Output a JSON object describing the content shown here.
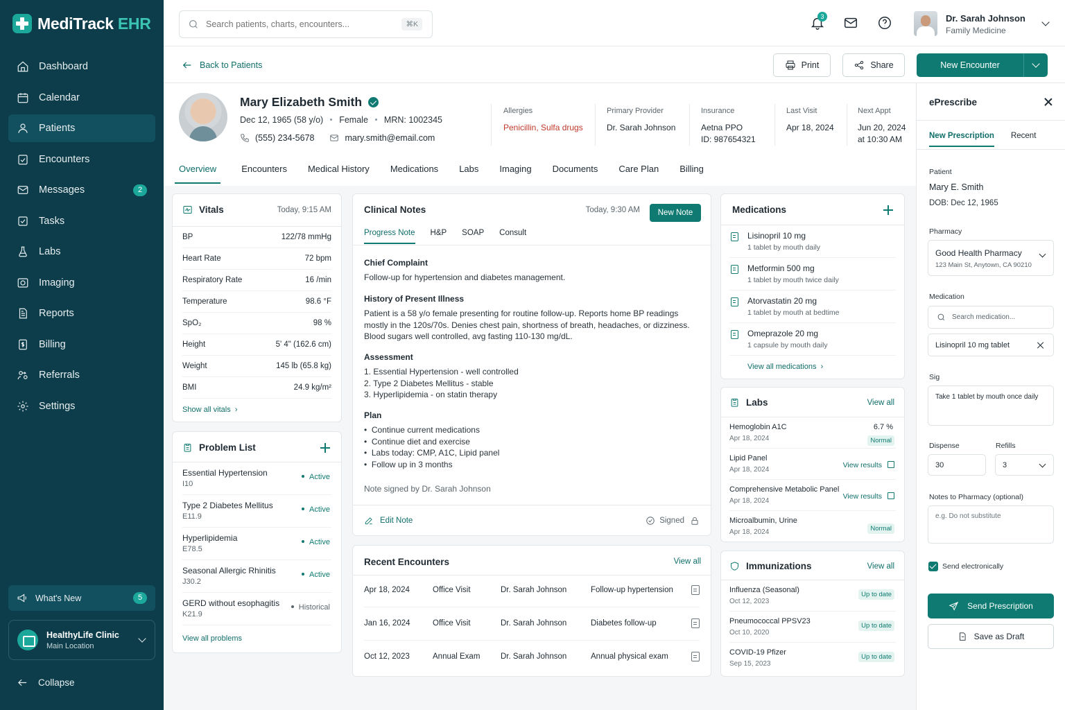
{
  "app": {
    "name_main": "MediTrack",
    "name_accent": " EHR"
  },
  "sidebar": {
    "items": [
      {
        "label": "Dashboard",
        "icon": "home-icon"
      },
      {
        "label": "Calendar",
        "icon": "calendar-icon"
      },
      {
        "label": "Patients",
        "icon": "user-icon",
        "active": true
      },
      {
        "label": "Encounters",
        "icon": "clipboard-icon"
      },
      {
        "label": "Messages",
        "icon": "mail-icon",
        "badge": "2"
      },
      {
        "label": "Tasks",
        "icon": "check-square-icon"
      },
      {
        "label": "Labs",
        "icon": "flask-icon"
      },
      {
        "label": "Imaging",
        "icon": "image-icon"
      },
      {
        "label": "Reports",
        "icon": "report-icon"
      },
      {
        "label": "Billing",
        "icon": "dollar-icon"
      },
      {
        "label": "Referrals",
        "icon": "referral-icon"
      },
      {
        "label": "Settings",
        "icon": "gear-icon"
      }
    ],
    "whats_new": {
      "label": "What's New",
      "badge": "5"
    },
    "clinic": {
      "name": "HealthyLife Clinic",
      "location": "Main Location"
    },
    "collapse": "Collapse"
  },
  "topbar": {
    "search_placeholder": "Search patients, charts, encounters...",
    "search_shortcut": "⌘K",
    "notification_count": "3",
    "user": {
      "name": "Dr. Sarah Johnson",
      "role": "Family Medicine"
    }
  },
  "actions": {
    "back": "Back to Patients",
    "print": "Print",
    "share": "Share",
    "new_encounter": "New Encounter"
  },
  "patient": {
    "name": "Mary Elizabeth Smith",
    "dob": "Dec 12, 1965 (58 y/o)",
    "sex": "Female",
    "mrn": "MRN: 1002345",
    "phone": "(555) 234-5678",
    "email": "mary.smith@email.com",
    "allergies_label": "Allergies",
    "allergies": "Penicillin, Sulfa drugs",
    "provider_label": "Primary Provider",
    "provider": "Dr. Sarah Johnson",
    "insurance_label": "Insurance",
    "insurance": "Aetna PPO",
    "insurance_id": "ID: 987654321",
    "last_visit_label": "Last Visit",
    "last_visit": "Apr 18, 2024",
    "next_appt_label": "Next Appt",
    "next_appt": "Jun 20, 2024",
    "next_appt_time": "at 10:30 AM"
  },
  "tabs": [
    "Overview",
    "Encounters",
    "Medical History",
    "Medications",
    "Labs",
    "Imaging",
    "Documents",
    "Care Plan",
    "Billing"
  ],
  "vitals": {
    "title": "Vitals",
    "time": "Today, 9:15 AM",
    "rows": [
      {
        "label": "BP",
        "value": "122/78 mmHg"
      },
      {
        "label": "Heart Rate",
        "value": "72 bpm"
      },
      {
        "label": "Respiratory Rate",
        "value": "16 /min"
      },
      {
        "label": "Temperature",
        "value": "98.6 °F"
      },
      {
        "label": "SpO₂",
        "value": "98 %"
      },
      {
        "label": "Height",
        "value": "5' 4\" (162.6 cm)"
      },
      {
        "label": "Weight",
        "value": "145 lb (65.8 kg)"
      },
      {
        "label": "BMI",
        "value": "24.9 kg/m²"
      }
    ],
    "link": "Show all vitals"
  },
  "problems": {
    "title": "Problem List",
    "rows": [
      {
        "name": "Essential Hypertension",
        "code": "I10",
        "status": "Active"
      },
      {
        "name": "Type 2 Diabetes Mellitus",
        "code": "E11.9",
        "status": "Active"
      },
      {
        "name": "Hyperlipidemia",
        "code": "E78.5",
        "status": "Active"
      },
      {
        "name": "Seasonal Allergic Rhinitis",
        "code": "J30.2",
        "status": "Active"
      },
      {
        "name": "GERD without esophagitis",
        "code": "K21.9",
        "status": "Historical"
      }
    ],
    "link": "View all problems"
  },
  "notes": {
    "title": "Clinical Notes",
    "time": "Today, 9:30 AM",
    "new_note": "New Note",
    "tabs": [
      "Progress Note",
      "H&P",
      "SOAP",
      "Consult"
    ],
    "chief_h": "Chief Complaint",
    "chief": "Follow-up for hypertension and diabetes management.",
    "hpi_h": "History of Present Illness",
    "hpi": "Patient is a 58 y/o female presenting for routine follow-up. Reports home BP readings mostly in the 120s/70s. Denies chest pain, shortness of breath, headaches, or dizziness. Blood sugars well controlled, avg fasting 110-130 mg/dL.",
    "assess_h": "Assessment",
    "assess": [
      "1.  Essential Hypertension - well controlled",
      "2.  Type 2 Diabetes Mellitus - stable",
      "3.  Hyperlipidemia - on statin therapy"
    ],
    "plan_h": "Plan",
    "plan": [
      "Continue current medications",
      "Continue diet and exercise",
      "Labs today: CMP, A1C, Lipid panel",
      "Follow up in 3 months"
    ],
    "signed_by": "Note signed by Dr. Sarah Johnson",
    "edit": "Edit Note",
    "signed": "Signed"
  },
  "encounters": {
    "title": "Recent Encounters",
    "link": "View all",
    "rows": [
      {
        "date": "Apr 18, 2024",
        "type": "Office Visit",
        "provider": "Dr. Sarah Johnson",
        "reason": "Follow-up hypertension"
      },
      {
        "date": "Jan 16, 2024",
        "type": "Office Visit",
        "provider": "Dr. Sarah Johnson",
        "reason": "Diabetes follow-up"
      },
      {
        "date": "Oct 12, 2023",
        "type": "Annual Exam",
        "provider": "Dr. Sarah Johnson",
        "reason": "Annual physical exam"
      }
    ]
  },
  "medications": {
    "title": "Medications",
    "rows": [
      {
        "name": "Lisinopril 10 mg",
        "dose": "1 tablet by mouth daily"
      },
      {
        "name": "Metformin 500 mg",
        "dose": "1 tablet by mouth twice daily"
      },
      {
        "name": "Atorvastatin 20 mg",
        "dose": "1 tablet by mouth at bedtime"
      },
      {
        "name": "Omeprazole 20 mg",
        "dose": "1 capsule by mouth daily"
      }
    ],
    "link": "View all medications"
  },
  "labs": {
    "title": "Labs",
    "link": "View all",
    "rows": [
      {
        "name": "Hemoglobin A1C",
        "date": "Apr 18, 2024",
        "value": "6.7 %",
        "flag": "Normal"
      },
      {
        "name": "Lipid Panel",
        "date": "Apr 18, 2024",
        "action": "View results"
      },
      {
        "name": "Comprehensive Metabolic Panel",
        "date": "Apr 18, 2024",
        "action": "View results"
      },
      {
        "name": "Microalbumin, Urine",
        "date": "Apr 18, 2024",
        "flag": "Normal"
      }
    ]
  },
  "immunizations": {
    "title": "Immunizations",
    "link": "View all",
    "rows": [
      {
        "name": "Influenza (Seasonal)",
        "date": "Oct 12, 2023",
        "status": "Up to date"
      },
      {
        "name": "Pneumococcal PPSV23",
        "date": "Oct 10, 2020",
        "status": "Up to date"
      },
      {
        "name": "COVID-19 Pfizer",
        "date": "Sep 15, 2023",
        "status": "Up to date"
      }
    ]
  },
  "eprescribe": {
    "title": "ePrescribe",
    "tabs": [
      "New Prescription",
      "Recent"
    ],
    "patient_label": "Patient",
    "patient": "Mary E. Smith",
    "dob": "DOB: Dec 12, 1965",
    "pharmacy_label": "Pharmacy",
    "pharmacy": "Good Health Pharmacy",
    "pharmacy_addr": "123 Main St, Anytown, CA 90210",
    "medication_label": "Medication",
    "med_search": "Search medication...",
    "med_selected": "Lisinopril 10 mg tablet",
    "sig_label": "Sig",
    "sig": "Take 1 tablet by mouth once daily",
    "dispense_label": "Dispense",
    "dispense": "30",
    "refills_label": "Refills",
    "refills": "3",
    "notes_label": "Notes to Pharmacy (optional)",
    "notes_placeholder": "e.g. Do not substitute",
    "send_elec": "Send electronically",
    "send": "Send Prescription",
    "draft": "Save as Draft"
  }
}
